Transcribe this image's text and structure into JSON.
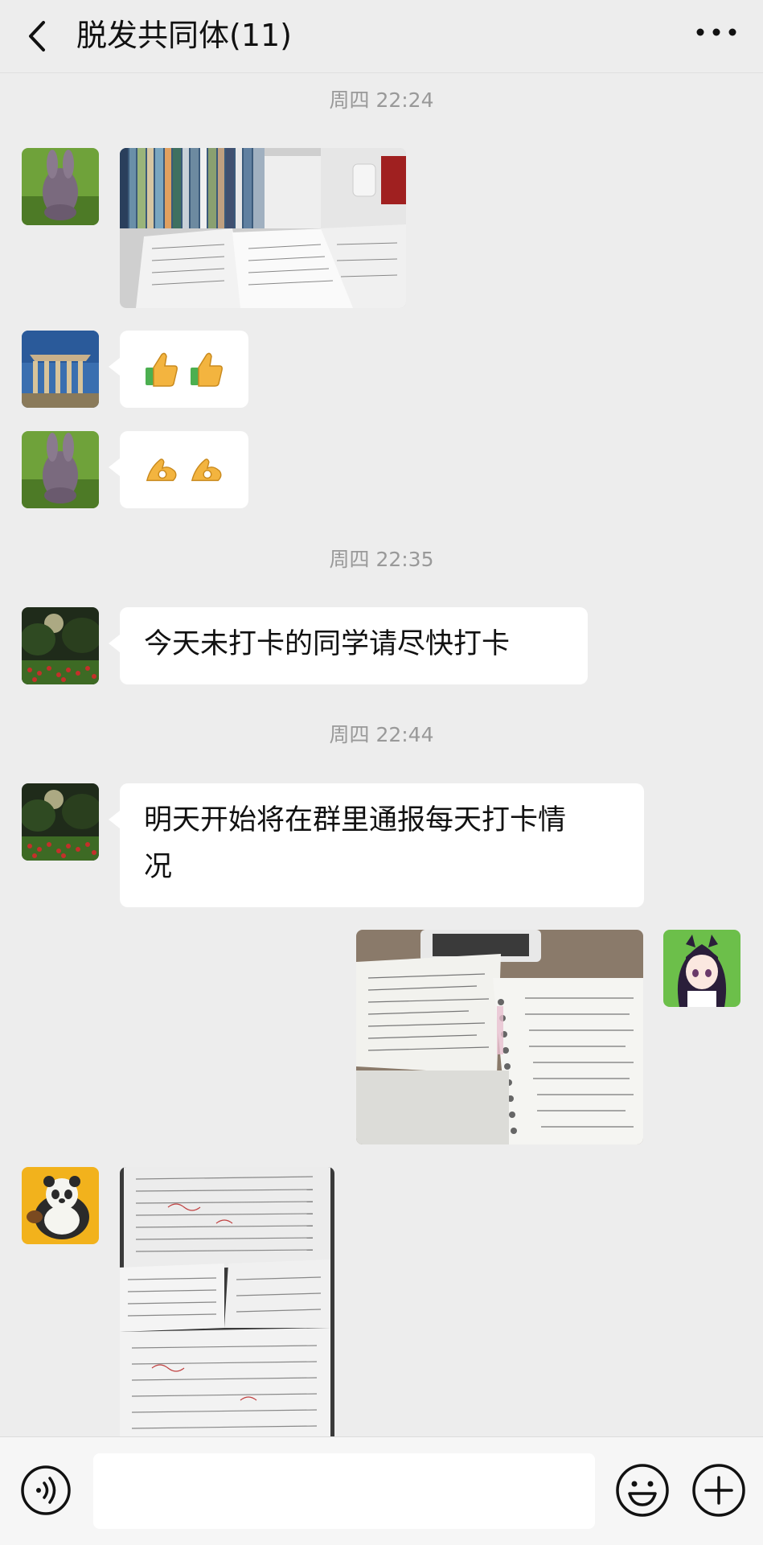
{
  "header": {
    "title": "脱发共同体(11)",
    "back_icon": "chevron-left-icon",
    "more_icon": "more-dots-icon"
  },
  "timestamps": [
    "周四 22:24",
    "周四 22:35",
    "周四 22:44"
  ],
  "messages": [
    {
      "sender": "other",
      "type": "image",
      "avatar": "bunny-avatar",
      "content": "photo of books and papers on desk"
    },
    {
      "sender": "other",
      "type": "emoji",
      "avatar": "temple-avatar",
      "emojis": [
        "thumbs-up-icon",
        "thumbs-up-icon"
      ]
    },
    {
      "sender": "other",
      "type": "emoji",
      "avatar": "bunny-avatar",
      "emojis": [
        "ok-hand-icon",
        "ok-hand-icon"
      ]
    },
    {
      "sender": "other",
      "type": "text",
      "avatar": "garden-avatar",
      "text": "今天未打卡的同学请尽快打卡"
    },
    {
      "sender": "other",
      "type": "text",
      "avatar": "garden-avatar",
      "text_line1": "明天开始将在群里通报每天打卡情",
      "text_line2": "况"
    },
    {
      "sender": "self",
      "type": "image",
      "avatar": "anime-girl-avatar",
      "content": "photo of open notebooks"
    },
    {
      "sender": "other",
      "type": "image",
      "avatar": "panda-avatar",
      "content": "photo of worksheets"
    }
  ],
  "input_bar": {
    "voice_icon": "voice-icon",
    "emoji_icon": "smiley-icon",
    "plus_icon": "plus-icon",
    "placeholder": ""
  },
  "colors": {
    "background": "#ededed",
    "bubble": "#ffffff",
    "timestamp": "#999999"
  }
}
